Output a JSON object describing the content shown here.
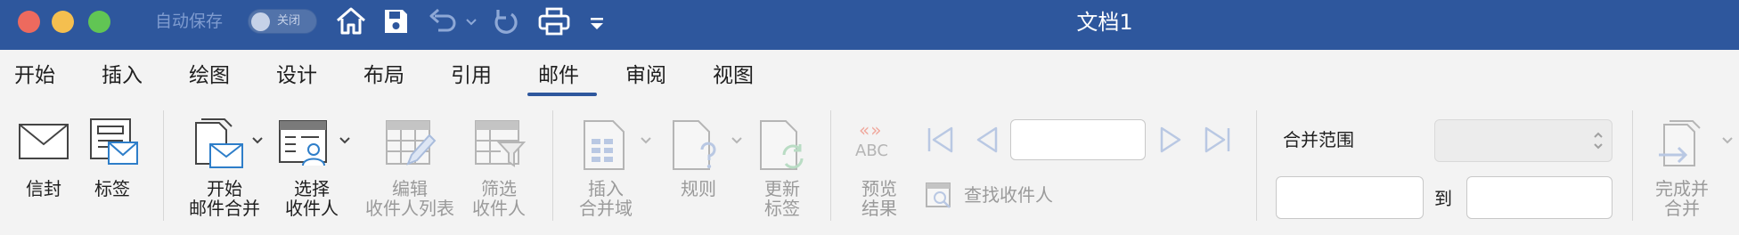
{
  "titlebar": {
    "autosave_label": "自动保存",
    "toggle_label": "关闭",
    "doc_title": "文档1",
    "icons": [
      "home-icon",
      "save-icon",
      "undo-icon",
      "redo-icon",
      "print-icon",
      "customize-toolbar-icon"
    ]
  },
  "tabs": [
    {
      "label": "开始"
    },
    {
      "label": "插入"
    },
    {
      "label": "绘图"
    },
    {
      "label": "设计"
    },
    {
      "label": "布局"
    },
    {
      "label": "引用"
    },
    {
      "label": "邮件"
    },
    {
      "label": "审阅"
    },
    {
      "label": "视图"
    }
  ],
  "active_tab": "邮件",
  "ribbon": {
    "envelope": "信封",
    "labels": "标签",
    "start_merge_line1": "开始",
    "start_merge_line2": "邮件合并",
    "select_recipients_line1": "选择",
    "select_recipients_line2": "收件人",
    "edit_list_line1": "编辑",
    "edit_list_line2": "收件人列表",
    "filter_line1": "筛选",
    "filter_line2": "收件人",
    "insert_field_line1": "插入",
    "insert_field_line2": "合并域",
    "rules": "规则",
    "update_labels_line1": "更新",
    "update_labels_line2": "标签",
    "abc_text": "ABC",
    "preview_line1": "预览",
    "preview_line2": "结果",
    "find_recipient": "查找收件人",
    "merge_range": "合并范围",
    "to": "到",
    "finish_line1": "完成并",
    "finish_line2": "合并"
  },
  "colors": {
    "titlebar": "#2e579d",
    "ribbon_bg": "#f3f3f3",
    "disabled_text": "#9a9a9a",
    "disabled_icon": "#b9c8e3"
  }
}
